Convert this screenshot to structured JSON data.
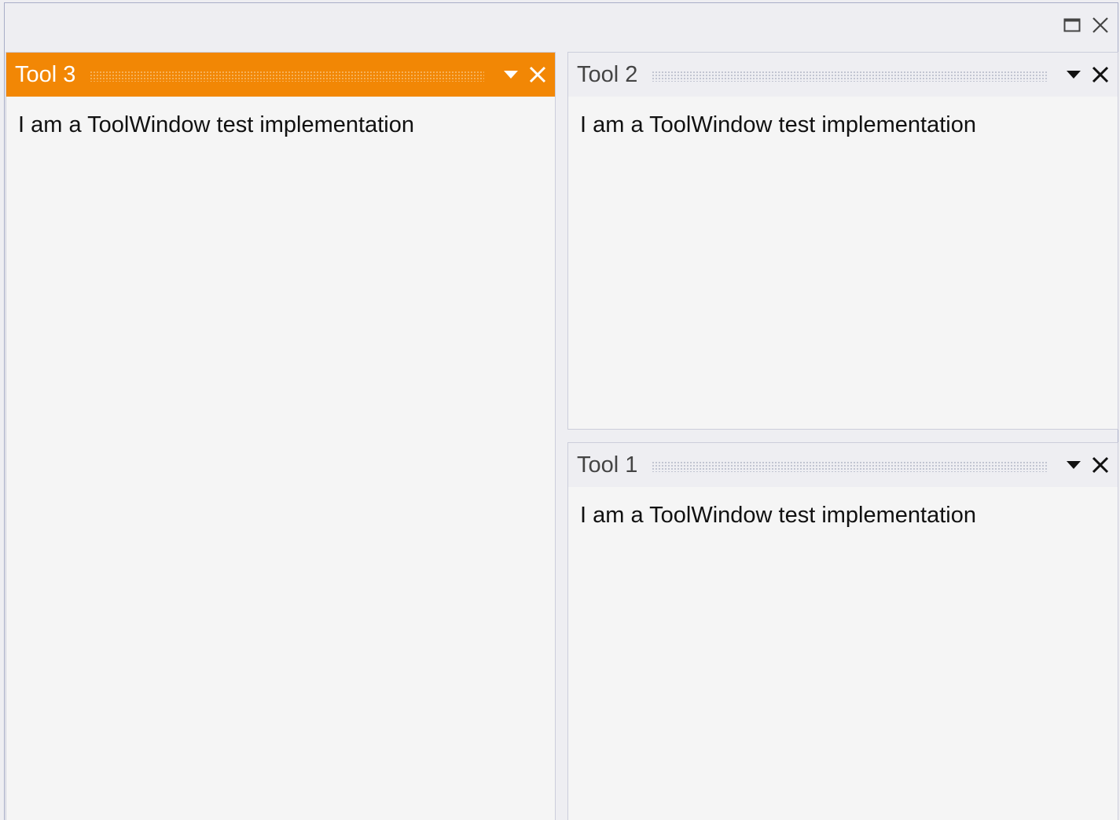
{
  "window": {
    "controls": {
      "maximize_icon": "maximize-icon",
      "close_icon": "close-icon"
    }
  },
  "panes": [
    {
      "title": "Tool 3",
      "content": "I am a ToolWindow test implementation",
      "active": true
    },
    {
      "title": "Tool 2",
      "content": "I am a ToolWindow test implementation",
      "active": false
    },
    {
      "title": "Tool 1",
      "content": "I am a ToolWindow test implementation",
      "active": false
    }
  ],
  "colors": {
    "active_header": "#f28705",
    "inactive_header": "#eeeef2",
    "pane_background": "#f5f5f5",
    "window_background": "#eeeef2"
  }
}
